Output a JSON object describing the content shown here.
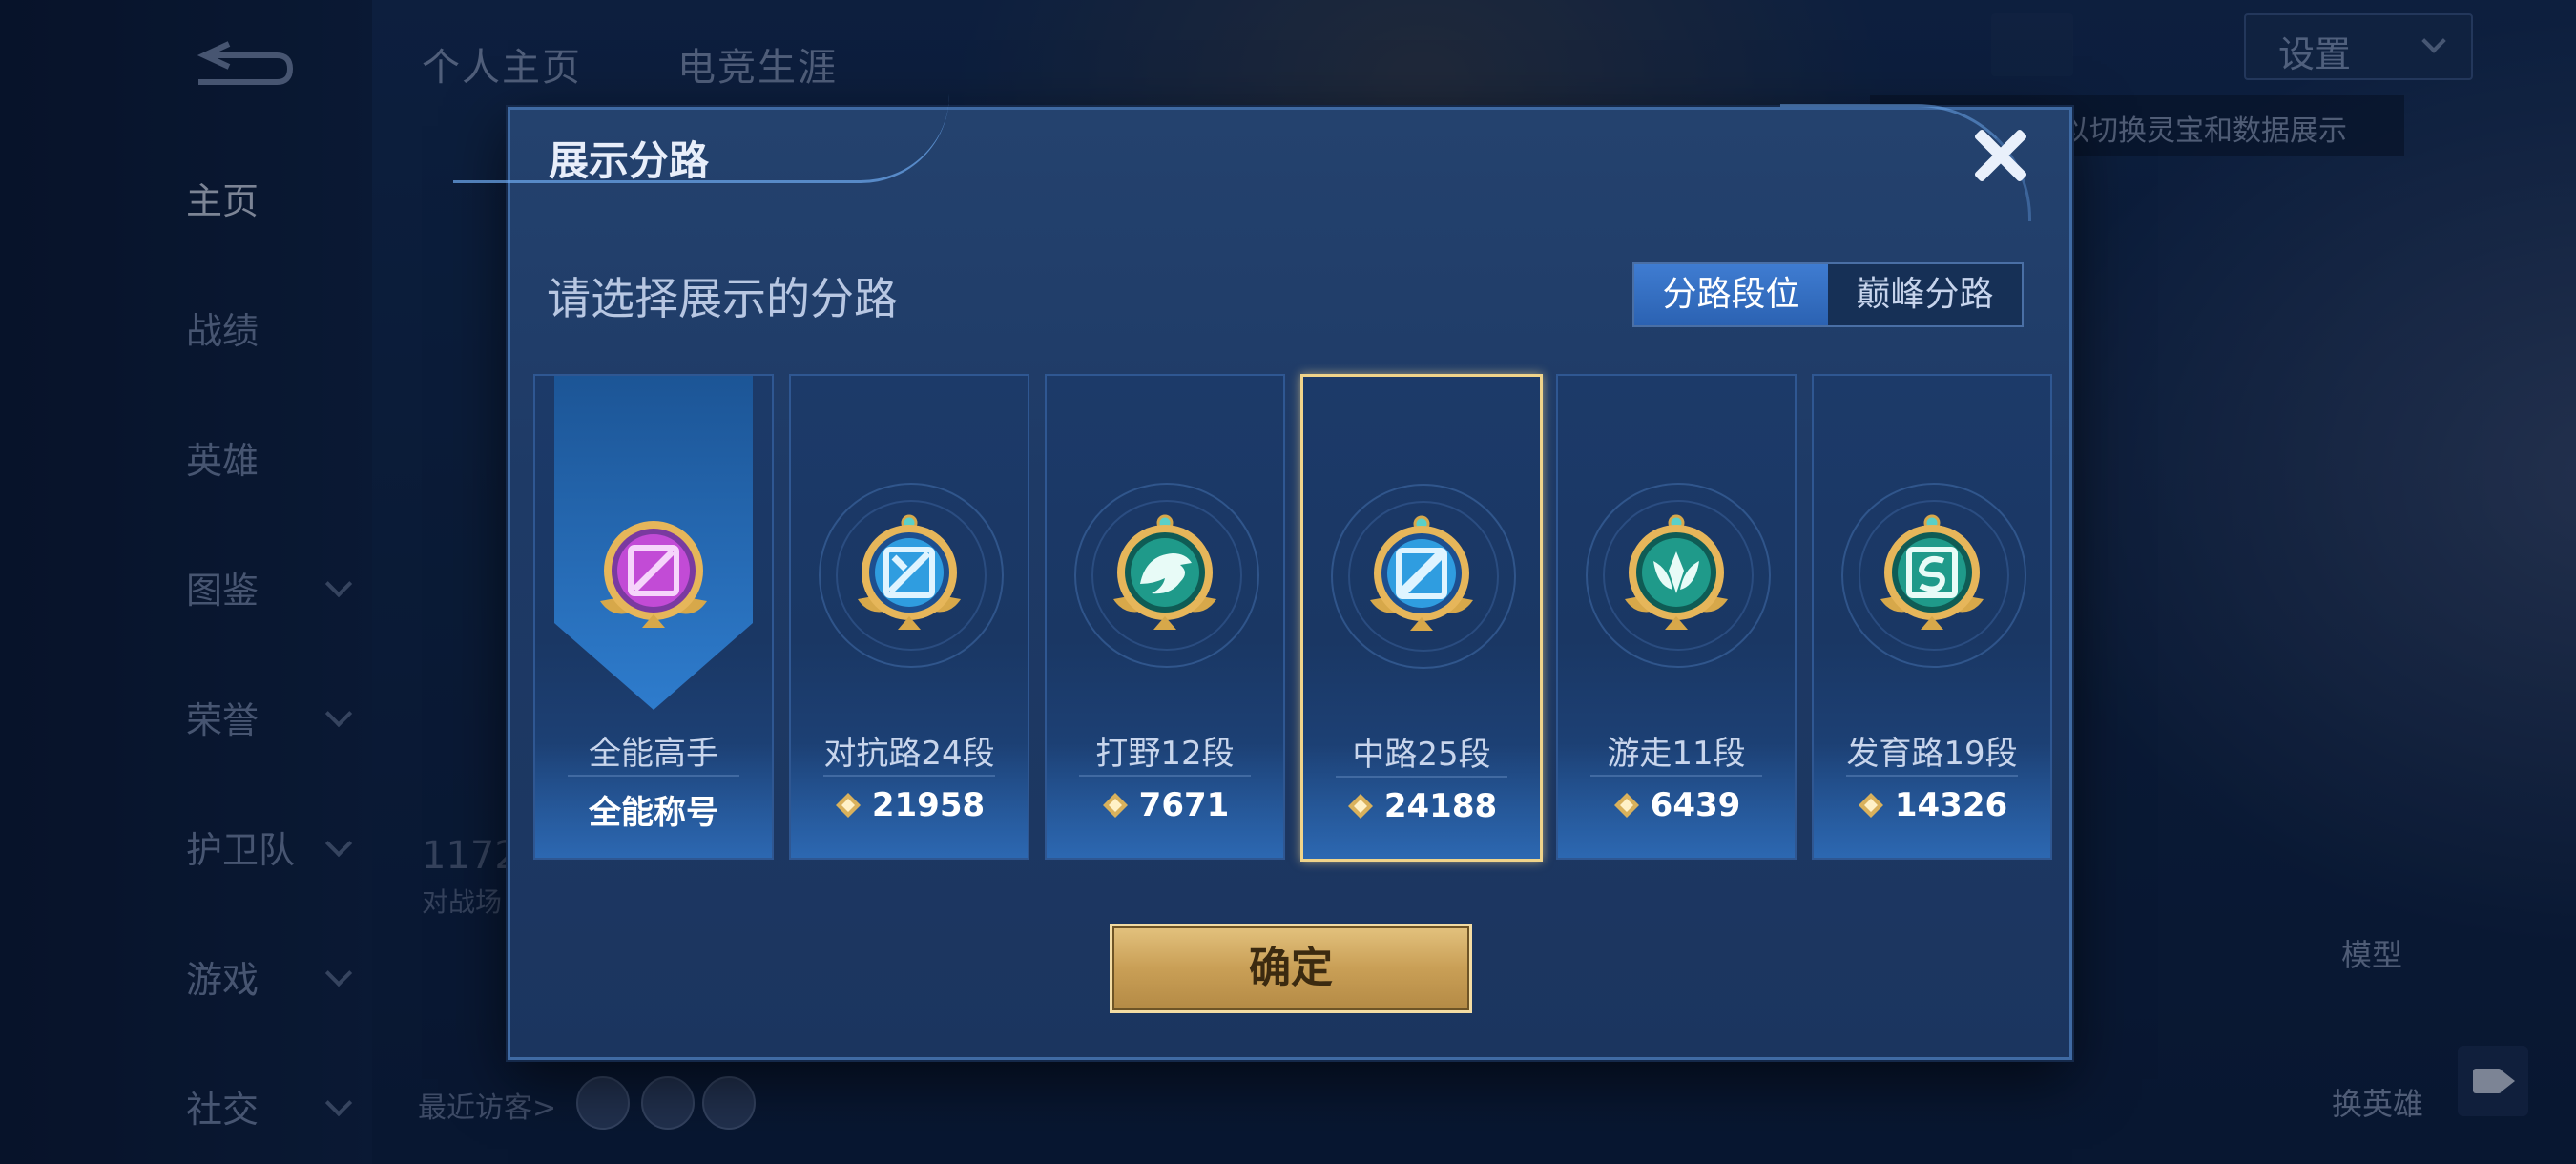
{
  "colors": {
    "modal_bg": "#1e3a66",
    "accent_blue": "#2b62b2",
    "gold": "#c99f56",
    "selected_border": "#f0d48a"
  },
  "nav": {
    "back_icon": "back-arrow-icon",
    "top_tabs": [
      "个人主页",
      "电竞生涯"
    ],
    "items": [
      {
        "label": "主页",
        "active": true
      },
      {
        "label": "战绩"
      },
      {
        "label": "英雄"
      },
      {
        "label": "图鉴"
      },
      {
        "label": "荣誉"
      },
      {
        "label": "护卫队"
      },
      {
        "label": "游戏"
      },
      {
        "label": "社交"
      }
    ]
  },
  "header": {
    "settings_label": "设置",
    "tip_text": "以切换灵宝和数据展示"
  },
  "background": {
    "stat_value": "1172",
    "stat_label": "对战场",
    "visitors_label": "最近访客>",
    "model_label": "模型",
    "swap_hero_label": "换英雄"
  },
  "modal": {
    "title": "展示分路",
    "subtitle": "请选择展示的分路",
    "tabs": [
      {
        "label": "分路段位",
        "active": true
      },
      {
        "label": "巅峰分路",
        "active": false
      }
    ],
    "cards": [
      {
        "name": "全能高手",
        "value": "全能称号",
        "icon": "all-round-badge-icon",
        "has_coin": false,
        "color": "#c24bd6"
      },
      {
        "name": "对抗路24段",
        "value": "21958",
        "icon": "clash-lane-badge-icon",
        "has_coin": true,
        "color": "#2f9de0"
      },
      {
        "name": "打野12段",
        "value": "7671",
        "icon": "jungle-badge-icon",
        "has_coin": true,
        "color": "#1f9a8a"
      },
      {
        "name": "中路25段",
        "value": "24188",
        "icon": "mid-lane-badge-icon",
        "has_coin": true,
        "color": "#2f9de0",
        "selected": true
      },
      {
        "name": "游走11段",
        "value": "6439",
        "icon": "roam-badge-icon",
        "has_coin": true,
        "color": "#1f9a8a"
      },
      {
        "name": "发育路19段",
        "value": "14326",
        "icon": "farm-lane-badge-icon",
        "has_coin": true,
        "color": "#1f9a8a"
      }
    ],
    "confirm_label": "确定"
  }
}
